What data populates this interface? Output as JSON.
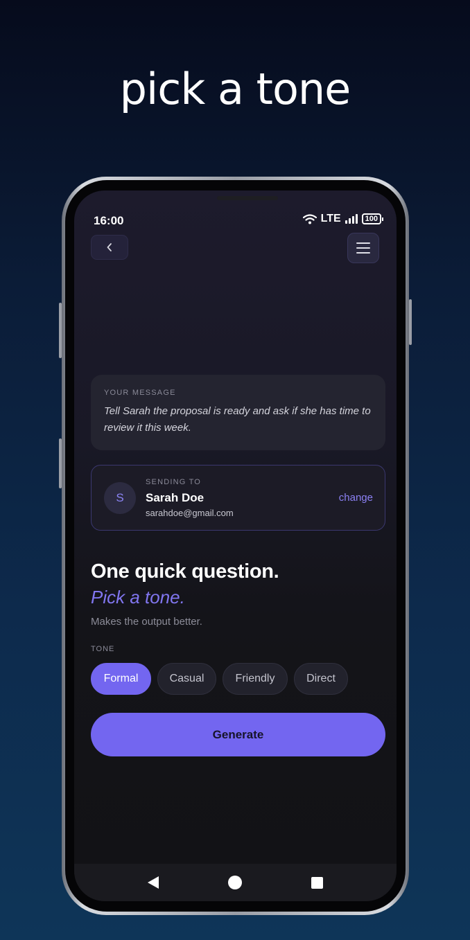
{
  "headline": "pick a tone",
  "status_bar": {
    "time": "16:00",
    "network": "LTE",
    "battery": "100"
  },
  "header": {
    "back_icon": "chevron-left-icon",
    "menu_icon": "hamburger-menu-icon"
  },
  "message_card": {
    "label": "YOUR MESSAGE",
    "text": "Tell Sarah the proposal is ready and ask if she has time to review it this week."
  },
  "recipient": {
    "label": "SENDING TO",
    "initial": "S",
    "name": "Sarah Doe",
    "email": "sarahdoe@gmail.com",
    "change_label": "change"
  },
  "question": {
    "title": "One quick question.",
    "subtitle": "Pick a tone.",
    "hint": "Makes the output better."
  },
  "tone": {
    "label": "TONE",
    "options": [
      "Formal",
      "Casual",
      "Friendly",
      "Direct"
    ],
    "selected": "Formal"
  },
  "generate_label": "Generate",
  "colors": {
    "accent": "#7366f0",
    "accent_text": "#8176f0",
    "card_bg": "#242430",
    "border_accent": "#3b3870"
  }
}
